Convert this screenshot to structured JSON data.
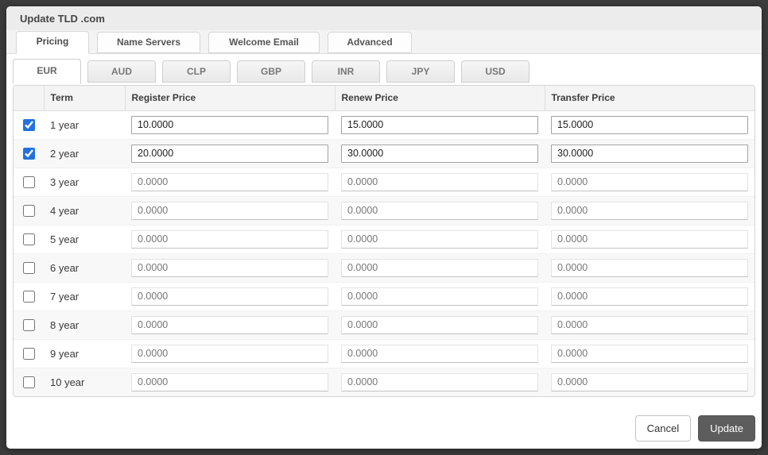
{
  "modal": {
    "title": "Update TLD .com"
  },
  "main_tabs": [
    {
      "label": "Pricing",
      "active": true
    },
    {
      "label": "Name Servers",
      "active": false
    },
    {
      "label": "Welcome Email",
      "active": false
    },
    {
      "label": "Advanced",
      "active": false
    }
  ],
  "currency_tabs": [
    {
      "label": "EUR",
      "active": true
    },
    {
      "label": "AUD",
      "active": false
    },
    {
      "label": "CLP",
      "active": false
    },
    {
      "label": "GBP",
      "active": false
    },
    {
      "label": "INR",
      "active": false
    },
    {
      "label": "JPY",
      "active": false
    },
    {
      "label": "USD",
      "active": false
    }
  ],
  "table": {
    "columns": {
      "term": "Term",
      "register": "Register Price",
      "renew": "Renew Price",
      "transfer": "Transfer Price"
    },
    "rows": [
      {
        "term": "1 year",
        "checked": true,
        "register": "10.0000",
        "renew": "15.0000",
        "transfer": "15.0000"
      },
      {
        "term": "2 year",
        "checked": true,
        "register": "20.0000",
        "renew": "30.0000",
        "transfer": "30.0000"
      },
      {
        "term": "3 year",
        "checked": false,
        "register": "0.0000",
        "renew": "0.0000",
        "transfer": "0.0000"
      },
      {
        "term": "4 year",
        "checked": false,
        "register": "0.0000",
        "renew": "0.0000",
        "transfer": "0.0000"
      },
      {
        "term": "5 year",
        "checked": false,
        "register": "0.0000",
        "renew": "0.0000",
        "transfer": "0.0000"
      },
      {
        "term": "6 year",
        "checked": false,
        "register": "0.0000",
        "renew": "0.0000",
        "transfer": "0.0000"
      },
      {
        "term": "7 year",
        "checked": false,
        "register": "0.0000",
        "renew": "0.0000",
        "transfer": "0.0000"
      },
      {
        "term": "8 year",
        "checked": false,
        "register": "0.0000",
        "renew": "0.0000",
        "transfer": "0.0000"
      },
      {
        "term": "9 year",
        "checked": false,
        "register": "0.0000",
        "renew": "0.0000",
        "transfer": "0.0000"
      },
      {
        "term": "10 year",
        "checked": false,
        "register": "0.0000",
        "renew": "0.0000",
        "transfer": "0.0000"
      }
    ]
  },
  "footer": {
    "cancel_label": "Cancel",
    "update_label": "Update"
  },
  "colors": {
    "backdrop": "#3c3c3c",
    "checkbox_accent": "#2172e0",
    "update_button": "#5d5d5d",
    "titlebar_bg": "#ececec"
  }
}
